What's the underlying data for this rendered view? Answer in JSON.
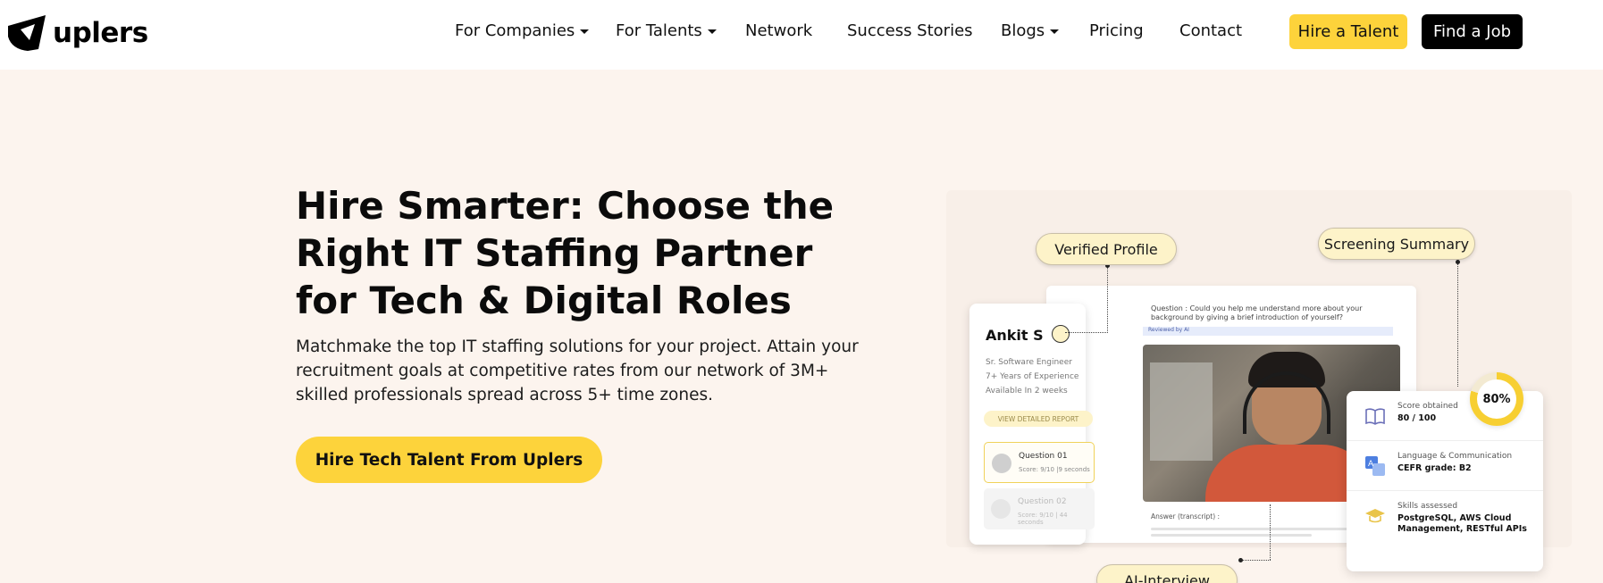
{
  "brand": {
    "name": "uplers"
  },
  "nav": {
    "links": [
      {
        "label": "For Companies",
        "dropdown": true
      },
      {
        "label": "For Talents",
        "dropdown": true
      },
      {
        "label": "Network",
        "dropdown": false
      },
      {
        "label": "Success Stories",
        "dropdown": false
      },
      {
        "label": "Blogs",
        "dropdown": true
      },
      {
        "label": "Pricing",
        "dropdown": false
      },
      {
        "label": "Contact",
        "dropdown": false
      }
    ],
    "hire_button": "Hire a Talent",
    "job_button": "Find a Job"
  },
  "hero": {
    "title": "Hire Smarter: Choose the Right IT Staffing Partner for Tech & Digital Roles",
    "subtitle": "Matchmake the top IT staffing solutions for your project. Attain your recruitment goals at competitive rates from our network of 3M+ skilled professionals spread across 5+ time zones.",
    "cta": "Hire Tech Talent From Uplers"
  },
  "illustration": {
    "tags": {
      "verified": "Verified Profile",
      "screening": "Screening Summary",
      "interview": "AI-Interview"
    },
    "profile": {
      "name": "Ankit S",
      "role": "Sr. Software Engineer",
      "experience": "7+ Years of Experience",
      "availability": "Available In 2 weeks",
      "report_button": "VIEW DETAILED REPORT",
      "questions": [
        {
          "title": "Question 01",
          "score": "Score: 9/10   |9 seconds"
        },
        {
          "title": "Question 02",
          "score": "Score: 9/10   |  44 seconds"
        }
      ]
    },
    "interview": {
      "question": "Question :  Could you help me understand more about your background by giving a brief introduction of yourself?",
      "reviewed": "Reviewed by AI",
      "answer_label": "Answer (transcript) :"
    },
    "summary": {
      "percent": "80%",
      "percent_value": 0.8,
      "rows": [
        {
          "icon": "book-icon",
          "label": "Score obtained",
          "value": "80 / 100"
        },
        {
          "icon": "translate-icon",
          "label": "Language & Communication",
          "value": "CEFR grade: B2"
        },
        {
          "icon": "graduation-cap-icon",
          "label": "Skills assessed",
          "value": "PostgreSQL, AWS Cloud Management, RESTful APIs"
        }
      ]
    }
  },
  "colors": {
    "accent": "#fdd33b",
    "hero_bg": "#fcf4ee",
    "dark": "#000000"
  }
}
